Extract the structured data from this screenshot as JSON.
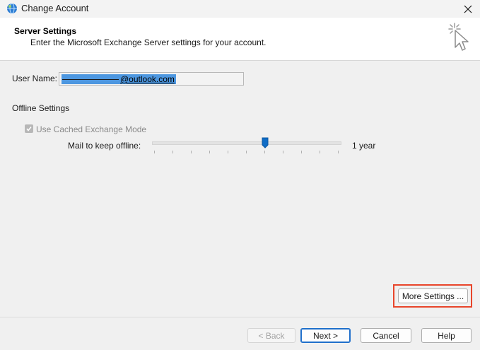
{
  "window": {
    "title": "Change Account",
    "app_icon": "globe-icon",
    "close_glyph": "✕"
  },
  "header": {
    "title": "Server Settings",
    "description": "Enter the Microsoft Exchange Server settings for your account.",
    "icon": "cursor-click-icon"
  },
  "form": {
    "user_name_label": "User Name:",
    "user_name_value_suffix": "@outlook.com",
    "offline_settings_label": "Offline Settings",
    "cached_mode_label": "Use Cached Exchange Mode",
    "cached_mode_checked": true,
    "mail_offline_label": "Mail to keep offline:",
    "mail_offline_value": "1 year",
    "slider_position_fraction": 0.6
  },
  "buttons": {
    "more_settings": "More Settings ...",
    "back": "< Back",
    "next": "Next >",
    "cancel": "Cancel",
    "help": "Help"
  },
  "colors": {
    "accent": "#1f6fcb",
    "selection": "#4d97e0",
    "highlight_box": "#e8452b"
  }
}
